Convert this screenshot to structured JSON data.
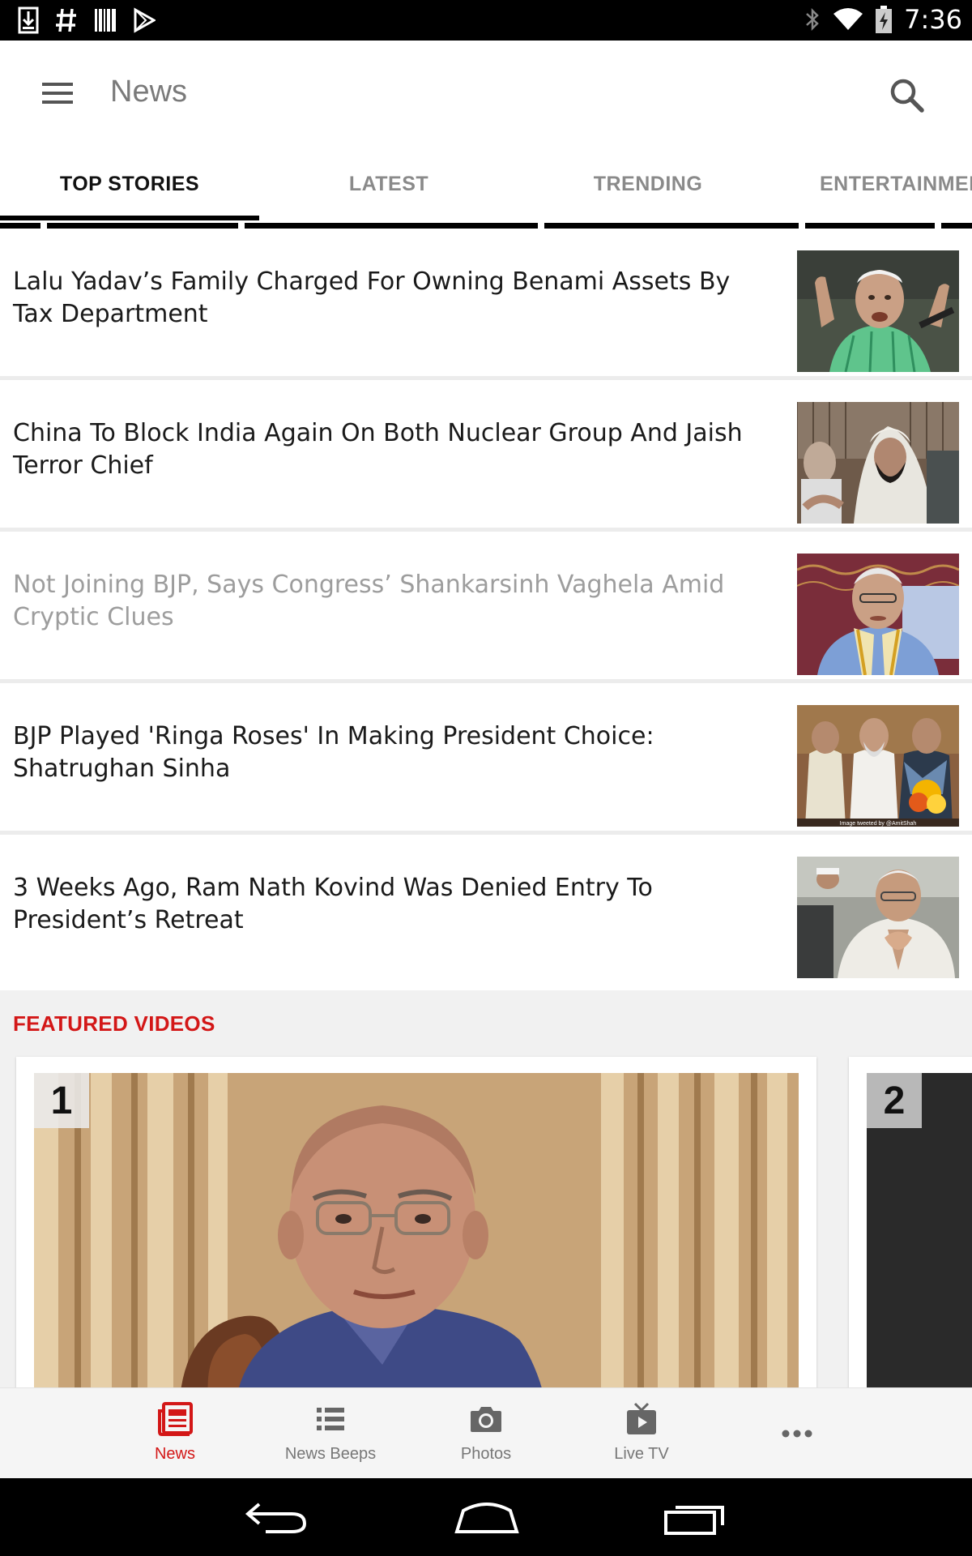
{
  "status_bar": {
    "time": "7:36",
    "left_icons": [
      "download-icon",
      "hash-icon",
      "barcode-icon",
      "play-store-icon"
    ],
    "right_icons": [
      "bluetooth-icon",
      "wifi-icon",
      "battery-charging-icon"
    ]
  },
  "app_bar": {
    "title": "News",
    "menu_icon": "hamburger-menu-icon",
    "search_icon": "search-icon"
  },
  "tabs": [
    {
      "label": "TOP STORIES",
      "active": true
    },
    {
      "label": "LATEST",
      "active": false
    },
    {
      "label": "TRENDING",
      "active": false
    },
    {
      "label": "ENTERTAINMENT",
      "active": false
    }
  ],
  "stories": [
    {
      "title": "Lalu Yadav’s Family Charged For Owning Benami Assets By Tax Department",
      "read": false
    },
    {
      "title": "China To Block India Again On Both Nuclear Group And Jaish Terror Chief",
      "read": false
    },
    {
      "title": "Not Joining BJP, Says Congress’ Shankarsinh Vaghela Amid Cryptic Clues",
      "read": true
    },
    {
      "title": "BJP Played 'Ringa Roses' In Making President Choice: Shatrughan Sinha",
      "read": false,
      "thumb_caption": "Image tweeted by @AmitShah"
    },
    {
      "title": "3 Weeks Ago, Ram Nath Kovind Was Denied Entry To President’s Retreat",
      "read": false
    }
  ],
  "featured": {
    "title": "FEATURED VIDEOS",
    "videos": [
      {
        "number": "1"
      },
      {
        "number": "2"
      }
    ]
  },
  "bottom_nav": [
    {
      "label": "News",
      "icon": "newspaper-icon",
      "active": true
    },
    {
      "label": "News Beeps",
      "icon": "list-icon",
      "active": false
    },
    {
      "label": "Photos",
      "icon": "camera-icon",
      "active": false
    },
    {
      "label": "Live TV",
      "icon": "tv-icon",
      "active": false
    },
    {
      "label": "",
      "icon": "more-icon",
      "active": false
    }
  ],
  "colors": {
    "accent": "#d31717",
    "status_bar": "#000000",
    "read_text": "#9d9d9d"
  }
}
